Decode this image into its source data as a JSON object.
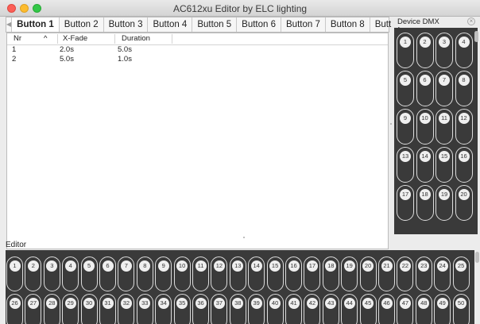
{
  "window": {
    "title": "AC612xu Editor by ELC lighting"
  },
  "tabs": [
    "Button 1",
    "Button 2",
    "Button 3",
    "Button 4",
    "Button 5",
    "Button 6",
    "Button 7",
    "Button 8",
    "Butt"
  ],
  "active_tab": "Button 1",
  "table": {
    "columns": [
      "Nr",
      "X-Fade",
      "Duration"
    ],
    "sort_indicator": "^",
    "rows": [
      {
        "nr": "1",
        "xfade": "2.0s",
        "duration": "5.0s"
      },
      {
        "nr": "2",
        "xfade": "5.0s",
        "duration": "1.0s"
      }
    ]
  },
  "device_dmx": {
    "title": "Device DMX",
    "channels": [
      "1",
      "2",
      "3",
      "4",
      "5",
      "6",
      "7",
      "8",
      "9",
      "10",
      "11",
      "12",
      "13",
      "14",
      "15",
      "16",
      "17",
      "18",
      "19",
      "20"
    ]
  },
  "editor": {
    "title": "Editor",
    "channels": [
      "1",
      "2",
      "3",
      "4",
      "5",
      "6",
      "7",
      "8",
      "9",
      "10",
      "11",
      "12",
      "13",
      "14",
      "15",
      "16",
      "17",
      "18",
      "19",
      "20",
      "21",
      "22",
      "23",
      "24",
      "25",
      "26",
      "27",
      "28",
      "29",
      "30",
      "31",
      "32",
      "33",
      "34",
      "35",
      "36",
      "37",
      "38",
      "39",
      "40",
      "41",
      "42",
      "43",
      "44",
      "45",
      "46",
      "47",
      "48",
      "49",
      "50"
    ]
  }
}
